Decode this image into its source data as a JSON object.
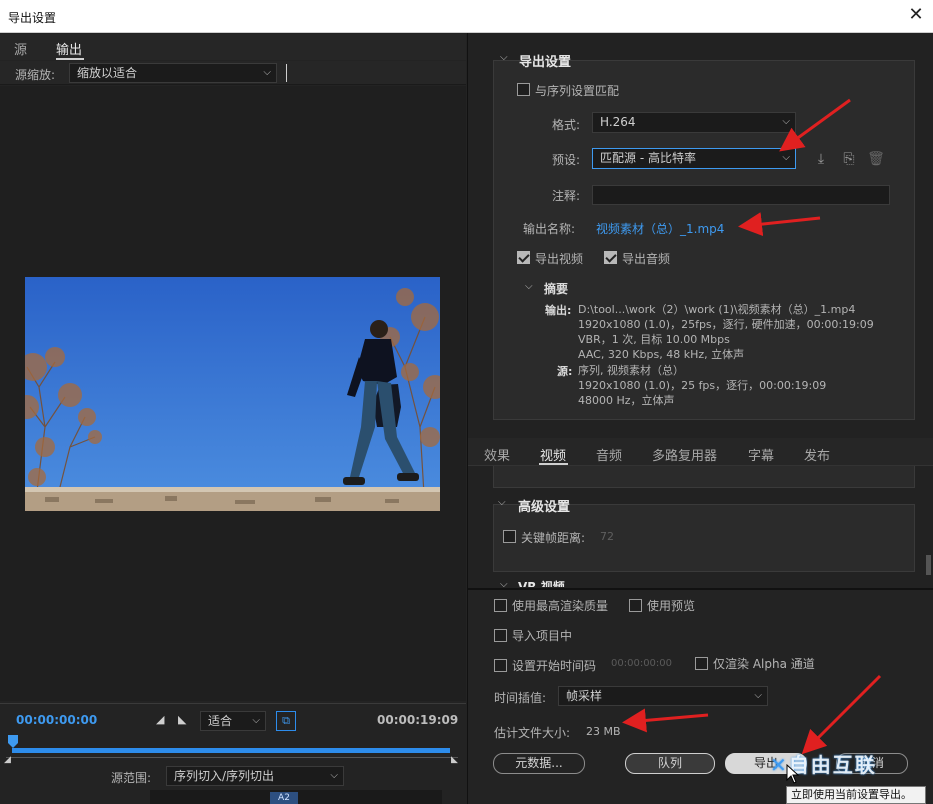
{
  "window": {
    "title": "导出设置",
    "close_glyph": "✕"
  },
  "left": {
    "tabs": [
      "源",
      "输出"
    ],
    "source_scale_label": "源缩放:",
    "source_scale_value": "缩放以适合",
    "timeline": {
      "start_time": "00:00:00:00",
      "end_time": "00:00:19:09",
      "fit_value": "适合",
      "range_label": "源范围:",
      "range_value": "序列切入/序列切出",
      "footer_badge": "A2"
    }
  },
  "right": {
    "export_settings": {
      "section_title": "导出设置",
      "match_sequence": {
        "label": "与序列设置匹配",
        "checked": false
      },
      "format_label": "格式:",
      "format_value": "H.264",
      "preset_label": "预设:",
      "preset_value": "匹配源 - 高比特率",
      "comment_label": "注释:",
      "comment_value": "",
      "output_name_label": "输出名称:",
      "output_name_value": "视频素材（总）_1.mp4",
      "export_video": {
        "label": "导出视频",
        "checked": true
      },
      "export_audio": {
        "label": "导出音频",
        "checked": true
      },
      "summary": {
        "title": "摘要",
        "output_key": "输出:",
        "output_lines": [
          "D:\\tool...\\work（2）\\work (1)\\视频素材（总）_1.mp4",
          "1920x1080 (1.0)，25fps，逐行, 硬件加速，00:00:19:09",
          "VBR，1 次, 目标 10.00 Mbps",
          "AAC, 320 Kbps, 48  kHz, 立体声"
        ],
        "source_key": "源:",
        "source_lines": [
          "序列, 视频素材（总）",
          "1920x1080 (1.0)，25 fps，逐行，00:00:19:09",
          "48000 Hz，立体声"
        ]
      }
    },
    "tabs": [
      "效果",
      "视频",
      "音频",
      "多路复用器",
      "字幕",
      "发布"
    ],
    "active_tab": "视频",
    "advanced": {
      "section_title": "高级设置",
      "keyframe_label": "关键帧距离:",
      "keyframe_value": "72",
      "next_section_partial": "VR 视频"
    },
    "bottom": {
      "max_render_quality": {
        "label": "使用最高渲染质量",
        "checked": false
      },
      "use_previews": {
        "label": "使用预览",
        "checked": false
      },
      "import_into_project": {
        "label": "导入项目中",
        "checked": false
      },
      "set_start_timecode": {
        "label": "设置开始时间码",
        "checked": false,
        "value": "00:00:00:00"
      },
      "render_alpha": {
        "label": "仅渲染 Alpha 通道",
        "checked": false
      },
      "interpolation_label": "时间插值:",
      "interpolation_value": "帧采样",
      "file_size_label": "估计文件大小:",
      "file_size_value": "23 MB",
      "metadata_button": "元数据...",
      "queue_button": "队列",
      "export_button": "导出",
      "cancel_button": "取消",
      "tooltip": "立即使用当前设置导出。",
      "watermark": "自由互联"
    }
  },
  "colors": {
    "accent_blue": "#3e9af0",
    "arrow_red": "#e02020",
    "bg": "#232323"
  },
  "icons": [
    "close-icon",
    "chevron-down-icon",
    "download-preset-icon",
    "import-preset-icon",
    "trash-icon",
    "mark-in-icon",
    "mark-out-icon",
    "crop-icon",
    "playhead-icon",
    "cursor-icon"
  ]
}
